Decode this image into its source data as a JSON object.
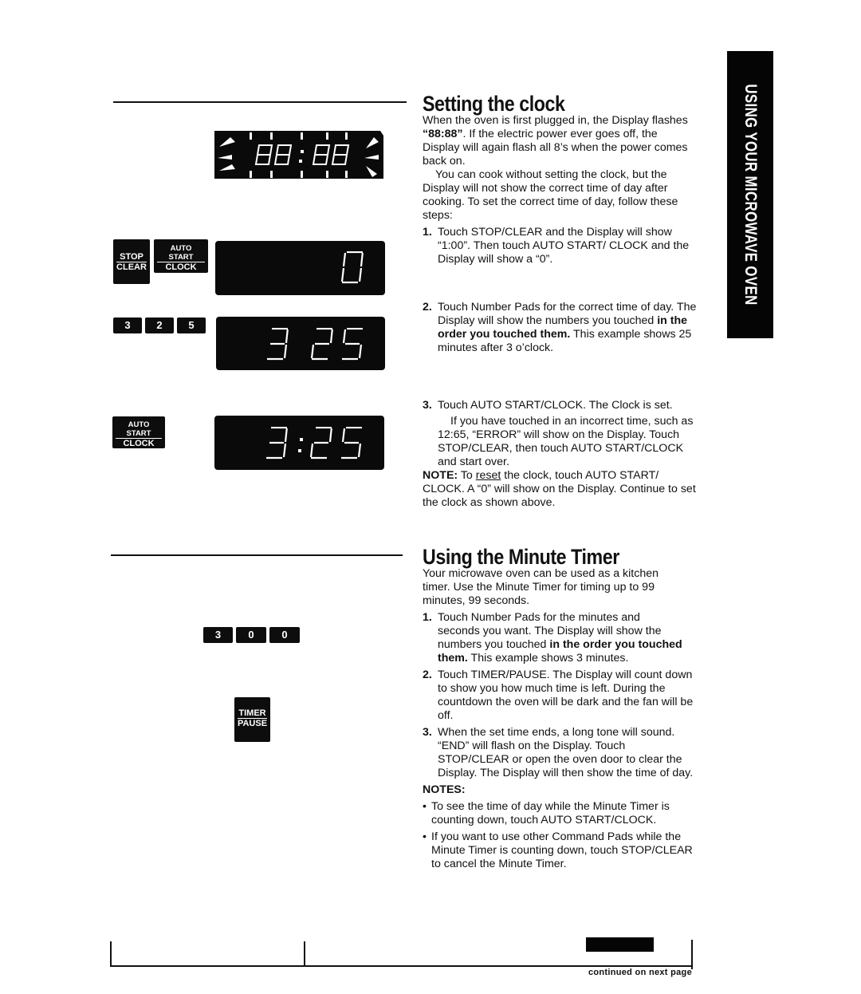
{
  "side_tab": {
    "label": "USING YOUR MICROWAVE OVEN"
  },
  "clock_section": {
    "title": "Setting the clock",
    "intro_1_a": "When the oven is first plugged in, the Display flashes ",
    "intro_1_bold": "“88:88”",
    "intro_1_b": ". If the electric power ever goes off, the Display will again flash all 8’s when the power comes back on.",
    "intro_2": "You can cook without setting the clock, but the Display will not show the correct time of day after cooking. To set the correct time of day, follow these steps:",
    "steps": [
      {
        "num": "1.",
        "text": "Touch STOP/CLEAR and the Display will show “1:00”. Then touch AUTO START/ CLOCK and the Display will show a “0”."
      },
      {
        "num": "2.",
        "text_a": "Touch Number Pads for the correct time of day. The Display will show the numbers you touched ",
        "bold": "in the order you touched them.",
        "text_b": " This example shows 25 minutes after 3 o’clock."
      },
      {
        "num": "3.",
        "text": "Touch AUTO START/CLOCK. The Clock is set.",
        "sub": "If you have touched in an incorrect time, such as 12:65, “ERROR” will show on the Display. Touch STOP/CLEAR, then touch AUTO START/CLOCK and start over."
      }
    ],
    "note_label": "NOTE:",
    "note_a": " To ",
    "note_underlined": "reset",
    "note_b": " the clock, touch AUTO START/ CLOCK. A “0” will show on the Display. Continue to set the clock as shown above."
  },
  "timer_section": {
    "title": "Using the Minute Timer",
    "intro": "Your microwave oven can be used as a kitchen timer. Use the Minute Timer for timing up to 99 minutes, 99 seconds.",
    "steps": [
      {
        "num": "1.",
        "text_a": "Touch Number Pads for the minutes and seconds you want. The Display will show the numbers you touched ",
        "bold": "in the order you touched them.",
        "text_b": " This example shows 3 minutes."
      },
      {
        "num": "2.",
        "text": "Touch TIMER/PAUSE. The Display will count down to show you how much time is left. During the countdown the oven will be dark and the fan will be off."
      },
      {
        "num": "3.",
        "text": "When the set time ends, a long tone will sound. “END” will flash on the Display. Touch STOP/CLEAR or open the oven door to clear the Display. The Display will then show the time of day."
      }
    ],
    "notes_label": "NOTES:",
    "notes": [
      "To see the time of day while the Minute Timer is counting down, touch AUTO START/CLOCK.",
      "If you want to use other Command Pads while the Minute Timer is counting down, touch STOP/CLEAR to cancel the Minute Timer."
    ]
  },
  "illustrations": {
    "flash_display": "88:88",
    "stop_clear_pad": {
      "top": "STOP",
      "bottom": "CLEAR"
    },
    "auto_start_pad": {
      "top": "AUTO START",
      "bottom": "CLOCK"
    },
    "display_step1": "0",
    "clock_number_pads": [
      "3",
      "2",
      "5"
    ],
    "display_step2": "3 25",
    "display_step3": "3:25",
    "timer_number_pads": [
      "3",
      "0",
      "0"
    ],
    "timer_pause_pad": {
      "top": "TIMER",
      "bottom": "PAUSE"
    }
  },
  "footer": {
    "continued": "continued on next page"
  },
  "bullet_char": "•"
}
